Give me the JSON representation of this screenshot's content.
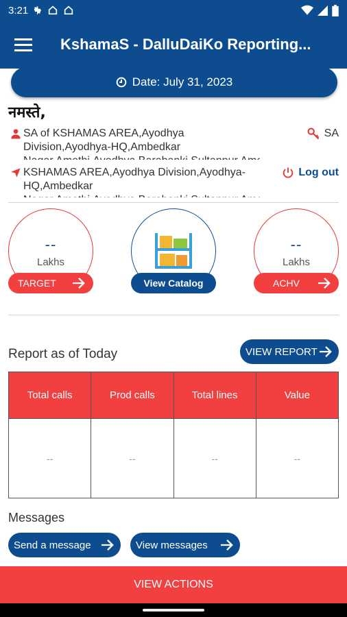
{
  "status_bar": {
    "time": "3:21"
  },
  "app_bar": {
    "title": "KshamaS - DalluDaiKo Reporting..."
  },
  "date_pill": {
    "text": "Date: July 31, 2023"
  },
  "greeting": "नमस्ते,",
  "user": {
    "role_text": "SA of KSHAMAS AREA,Ayodhya Division,Ayodhya-HQ,Ambedkar Nagar,Amethi,Ayodhya,Barabanki,Sultanpur,Amethi",
    "role_badge": "SA",
    "location_text": "KSHAMAS AREA,Ayodhya Division,Ayodhya-HQ,Ambedkar Nagar,Amethi,Ayodhya,Barabanki,Sultanpur,Amethi",
    "logout_label": "Log out"
  },
  "target": {
    "value": "--",
    "unit": "Lakhs",
    "button_label": "TARGET"
  },
  "catalog": {
    "button_label": "View Catalog"
  },
  "achievement": {
    "value": "--",
    "unit": "Lakhs",
    "button_label": "ACHV"
  },
  "report": {
    "title": "Report as of Today",
    "view_button_label": "VIEW REPORT",
    "columns": [
      "Total calls",
      "Prod calls",
      "Total lines",
      "Value"
    ],
    "values": [
      "--",
      "--",
      "--",
      "--"
    ]
  },
  "messages": {
    "title": "Messages",
    "send_label": "Send a message",
    "view_label": "View messages"
  },
  "actions": {
    "label": "VIEW ACTIONS"
  },
  "colors": {
    "primary": "#0d4d8f",
    "accent": "#f23f3f"
  }
}
